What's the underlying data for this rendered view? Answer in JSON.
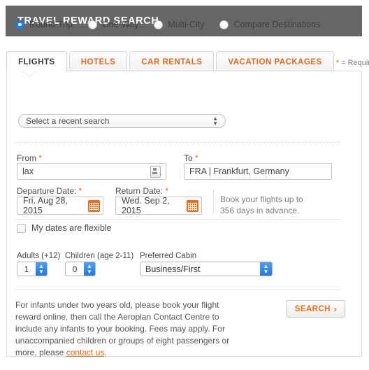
{
  "header": {
    "title": "TRAVEL REWARD SEARCH"
  },
  "tabs": {
    "items": [
      {
        "label": "FLIGHTS",
        "active": true
      },
      {
        "label": "HOTELS",
        "active": false
      },
      {
        "label": "CAR RENTALS",
        "active": false
      },
      {
        "label": "VACATION PACKAGES",
        "active": false
      }
    ],
    "required_star": "*",
    "required_text": " = Required"
  },
  "trip_type": {
    "options": [
      {
        "label": "Round-Trip",
        "selected": true
      },
      {
        "label": "One-Way",
        "selected": false
      },
      {
        "label": "Multi-City",
        "selected": false
      },
      {
        "label": "Compare Destinations",
        "selected": false
      }
    ]
  },
  "recent_search": {
    "value": "Select a recent search"
  },
  "origin": {
    "label": "From",
    "star": "*",
    "value": "lax"
  },
  "destination": {
    "label": "To",
    "star": "*",
    "value": "FRA | Frankfurt, Germany"
  },
  "departure": {
    "label": "Departure Date:",
    "star": "*",
    "value": "Fri. Aug 28, 2015"
  },
  "return": {
    "label": "Return Date:",
    "star": "*",
    "value": "Wed. Sep 2, 2015"
  },
  "advance_note": {
    "line1": "Book your flights up to",
    "line2": "356 days in advance."
  },
  "flexible": {
    "label": "My dates are flexible",
    "checked": false
  },
  "passengers": {
    "adults_label": "Adults (+12)",
    "adults_value": "1",
    "children_label": "Children (age 2-11)",
    "children_value": "0",
    "cabin_label": "Preferred Cabin",
    "cabin_value": "Business/First"
  },
  "footer": {
    "note_part1": "For infants under two years old, please book your flight reward online, then call the Aeroplan Contact Centre to include any infants to your booking. Fees may apply. For unaccompanied children or groups of eight passengers or more, please ",
    "note_link": "contact us",
    "note_part2": ".",
    "search_label": "SEARCH",
    "search_chevron": "›"
  },
  "colors": {
    "header_bg": "#666666",
    "accent_orange": "#e8661a",
    "radio_blue": "#1f7fe0"
  }
}
